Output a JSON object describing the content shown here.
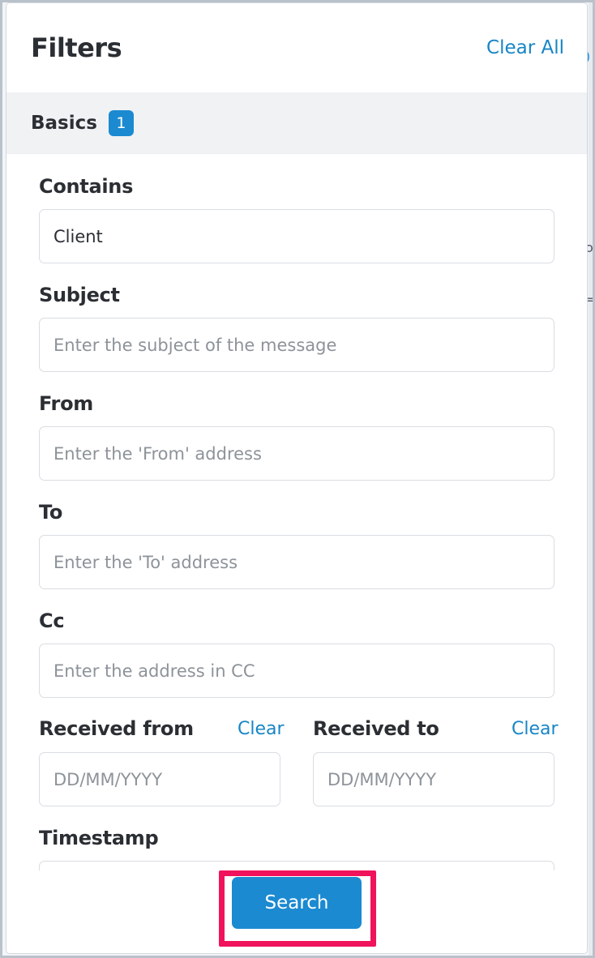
{
  "filters_panel": {
    "title": "Filters",
    "clear_all_label": "Clear All"
  },
  "basics_section": {
    "title": "Basics",
    "badge_count": "1"
  },
  "fields": {
    "contains": {
      "label": "Contains",
      "value": "Client",
      "placeholder": ""
    },
    "subject": {
      "label": "Subject",
      "value": "",
      "placeholder": "Enter the subject of the message"
    },
    "from": {
      "label": "From",
      "value": "",
      "placeholder": "Enter the 'From' address"
    },
    "to": {
      "label": "To",
      "value": "",
      "placeholder": "Enter the 'To' address"
    },
    "cc": {
      "label": "Cc",
      "value": "",
      "placeholder": "Enter the address in CC"
    },
    "received_from": {
      "label": "Received from",
      "clear_label": "Clear",
      "placeholder": "DD/MM/YYYY"
    },
    "received_to": {
      "label": "Received to",
      "clear_label": "Clear",
      "placeholder": "DD/MM/YYYY"
    },
    "timestamp": {
      "label": "Timestamp"
    }
  },
  "footer": {
    "search_label": "Search"
  },
  "colors": {
    "accent": "#1b8ad1",
    "highlight": "#f0135c",
    "text": "#2b2e33"
  }
}
